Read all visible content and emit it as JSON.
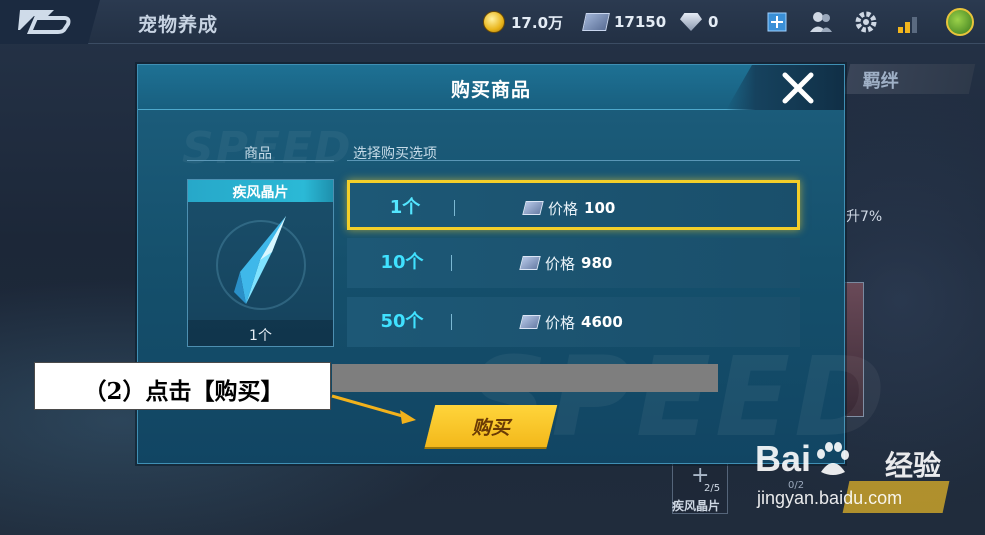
{
  "topbar": {
    "screen_title": "宠物养成",
    "coins": "17.0万",
    "gems": "17150",
    "diamonds": "0"
  },
  "background": {
    "side_tab_label": "羁绊",
    "side_text": "升7%",
    "slot_count": "2/5",
    "slot_label": "疾风晶片",
    "slot_label2": "0/2"
  },
  "dialog": {
    "title": "购买商品",
    "col_item": "商品",
    "col_options": "选择购买选项",
    "item": {
      "name": "疾风晶片",
      "qty": "1个"
    },
    "options": [
      {
        "qty": "1个",
        "price_label": "价格",
        "price": "100",
        "selected": true
      },
      {
        "qty": "10个",
        "price_label": "价格",
        "price": "980",
        "selected": false
      },
      {
        "qty": "50个",
        "price_label": "价格",
        "price": "4600",
        "selected": false
      }
    ],
    "buy_label": "购买"
  },
  "annotation": {
    "text": "（2）点击【购买】",
    "box_color": "#ffffff",
    "arrow_color": "#f2b21c"
  },
  "watermark": {
    "brand": "Bai",
    "brand_suffix": "经验",
    "url": "jingyan.baidu.com"
  },
  "colors": {
    "dialog_bg": "#15506c",
    "selected_border": "#f3cf2a",
    "qty_text": "#40e1ff",
    "buy_button": "#f3b81b"
  }
}
